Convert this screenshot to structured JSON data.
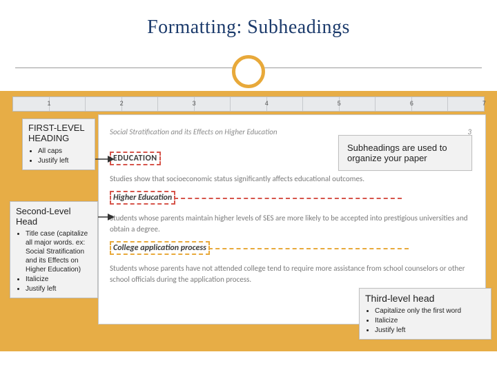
{
  "title": "Formatting: Subheadings",
  "ruler_numbers": [
    "1",
    "",
    "2",
    "",
    "3",
    "",
    "4",
    "",
    "5",
    "",
    "6",
    "",
    "7"
  ],
  "doc": {
    "running_head": "Social Stratification and its Effects on Higher Education",
    "page_no": "3",
    "h1": "EDUCATION",
    "p1": "Studies show that socioeconomic status significantly affects educational outcomes.",
    "h2": "Higher Education",
    "p2": "Students whose parents maintain higher levels of SES are more likely to be accepted into prestigious universities and obtain a degree.",
    "h3": "College application process",
    "p3": "Students whose parents have not attended college tend to require more assistance from school counselors or other school officials during the application process."
  },
  "callouts": {
    "first": {
      "title": "FIRST-LEVEL HEADING",
      "items": [
        "All caps",
        "Justify left"
      ]
    },
    "second": {
      "title": "Second-Level Head",
      "items": [
        "Title case (capitalize all major words. ex: Social Stratification and its Effects on Higher Education)",
        "Italicize",
        "Justify left"
      ]
    },
    "third": {
      "title": "Third-level head",
      "items": [
        "Capitalize only the first word",
        "Italicize",
        "Justify left"
      ]
    },
    "note": {
      "text": "Subheadings are used to organize your paper"
    }
  }
}
